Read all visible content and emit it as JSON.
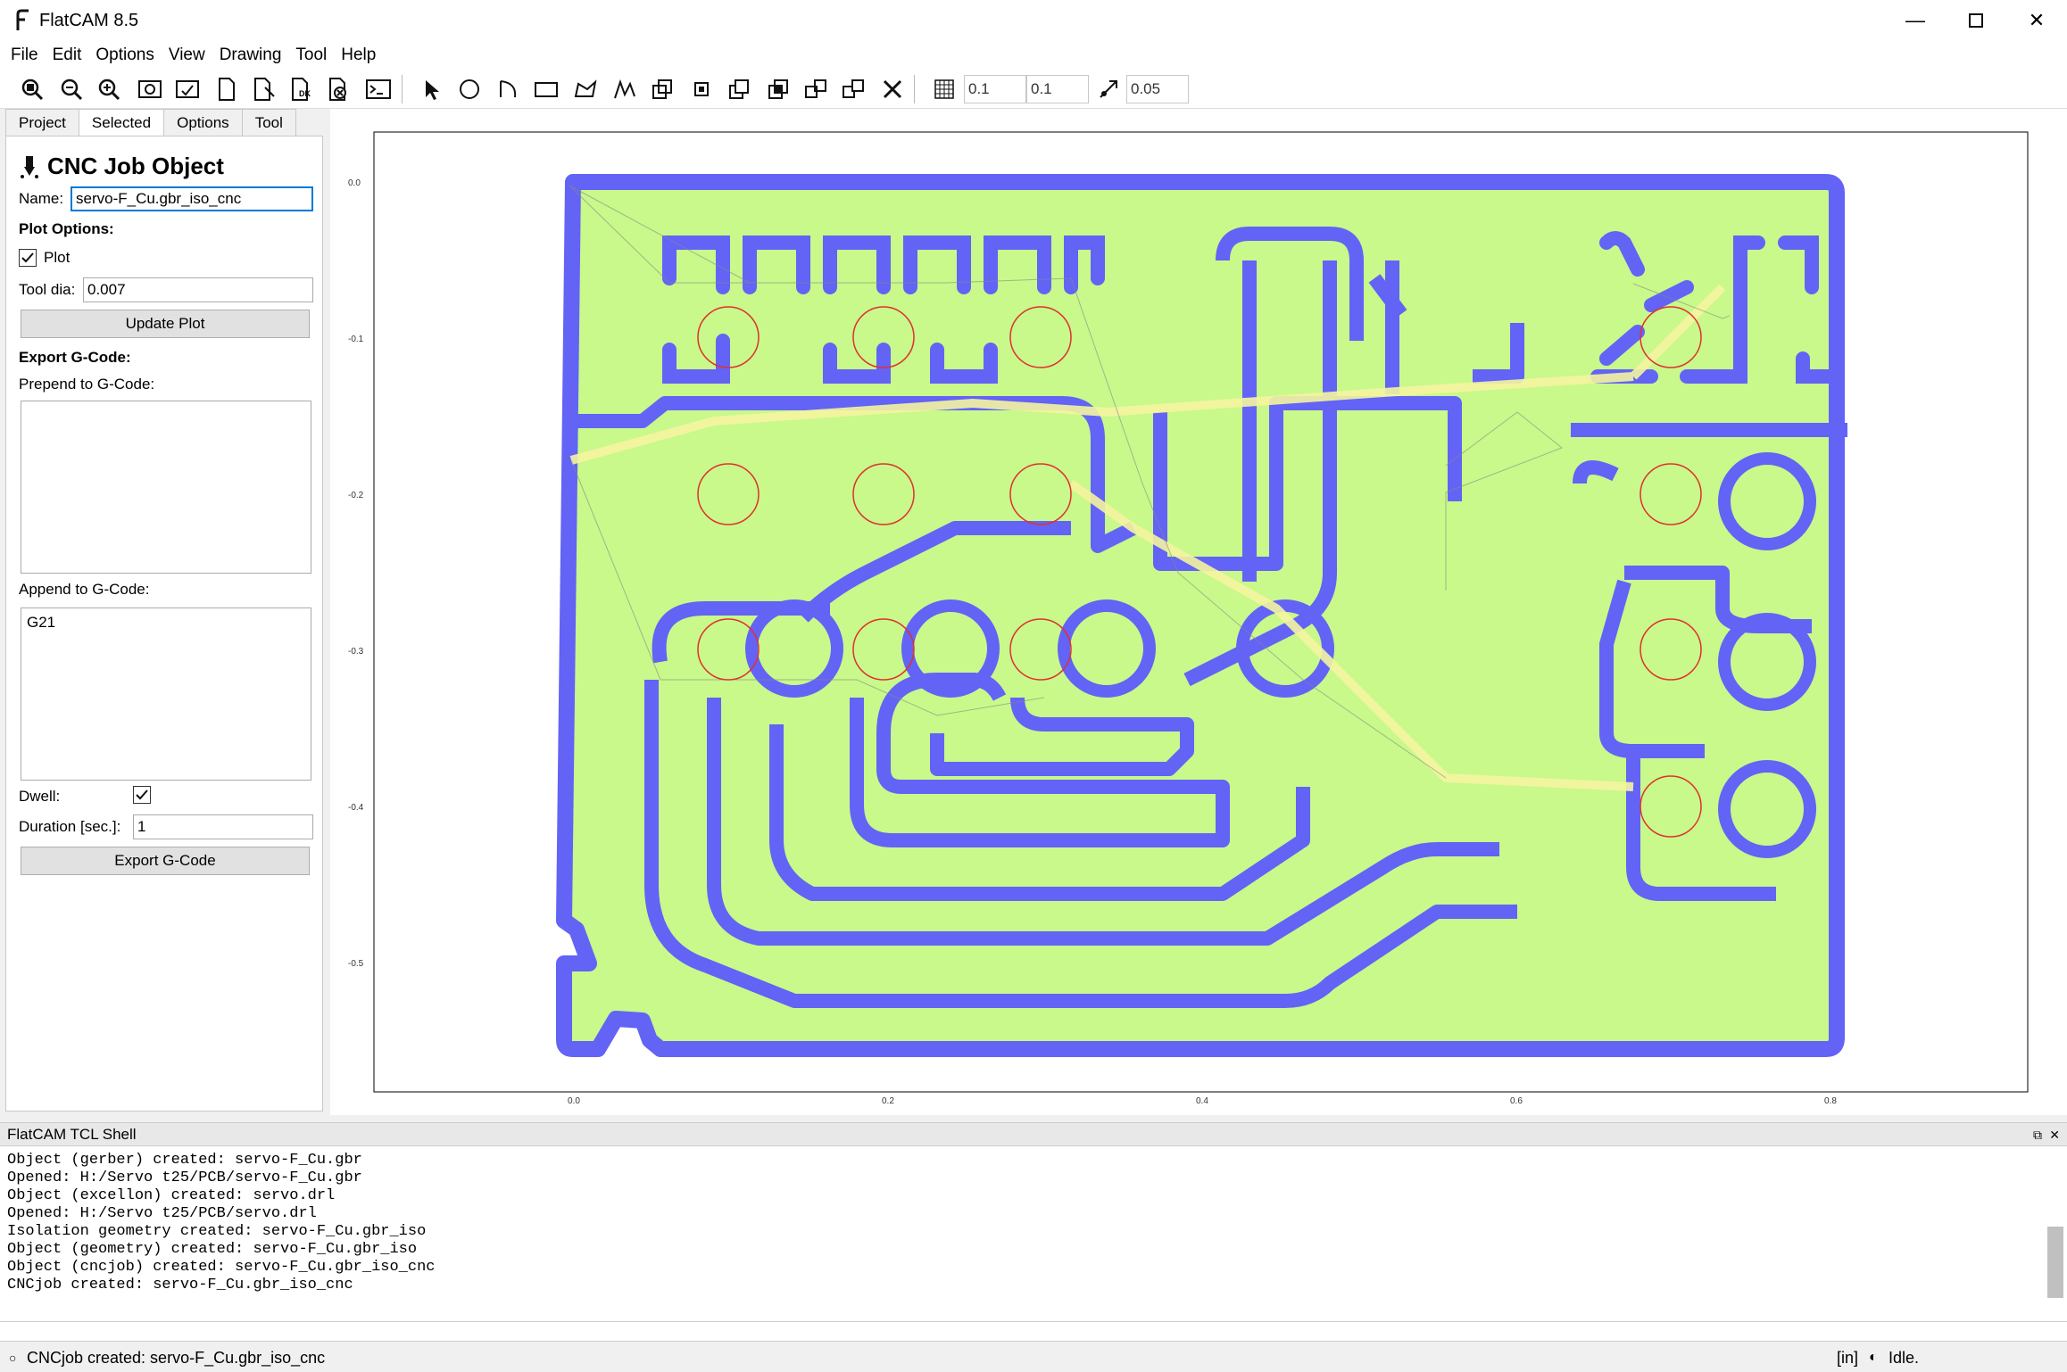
{
  "window": {
    "title": "FlatCAM 8.5"
  },
  "menu": [
    "File",
    "Edit",
    "Options",
    "View",
    "Drawing",
    "Tool",
    "Help"
  ],
  "toolbar": {
    "grid_x": "0.1",
    "grid_y": "0.1",
    "snap_max": "0.05"
  },
  "tabs": [
    "Project",
    "Selected",
    "Options",
    "Tool"
  ],
  "panel": {
    "heading": "CNC Job Object",
    "name_label": "Name:",
    "name_value": "servo-F_Cu.gbr_iso_cnc",
    "plot_options_label": "Plot Options:",
    "plot_label": "Plot",
    "tool_dia_label": "Tool dia:",
    "tool_dia_value": "0.007",
    "update_plot_label": "Update Plot",
    "export_label": "Export G-Code:",
    "prepend_label": "Prepend to G-Code:",
    "prepend_value": "",
    "append_label": "Append to G-Code:",
    "append_value": "G21",
    "dwell_label": "Dwell:",
    "duration_label": "Duration [sec.]:",
    "duration_value": "1",
    "export_button_label": "Export G-Code"
  },
  "plot": {
    "x_ticks": [
      "0.0",
      "0.2",
      "0.4",
      "0.6",
      "0.8"
    ],
    "y_ticks": [
      "0.0",
      "-0.1",
      "-0.2",
      "-0.3",
      "-0.4",
      "-0.5"
    ],
    "colors": {
      "fill": "#c8f98a",
      "trace": "#6363f6",
      "pad": "#e03030",
      "path": "#f4f4a0"
    }
  },
  "shell": {
    "title": "FlatCAM TCL Shell",
    "lines": [
      "Object (gerber) created: servo-F_Cu.gbr",
      "Opened: H:/Servo t25/PCB/servo-F_Cu.gbr",
      "Object (excellon) created: servo.drl",
      "Opened: H:/Servo t25/PCB/servo.drl",
      "Isolation geometry created: servo-F_Cu.gbr_iso",
      "Object (geometry) created: servo-F_Cu.gbr_iso",
      "Object (cncjob) created: servo-F_Cu.gbr_iso_cnc",
      "CNCjob created: servo-F_Cu.gbr_iso_cnc"
    ]
  },
  "status": {
    "message": "CNCjob created: servo-F_Cu.gbr_iso_cnc",
    "units": "[in]",
    "state": "Idle."
  }
}
